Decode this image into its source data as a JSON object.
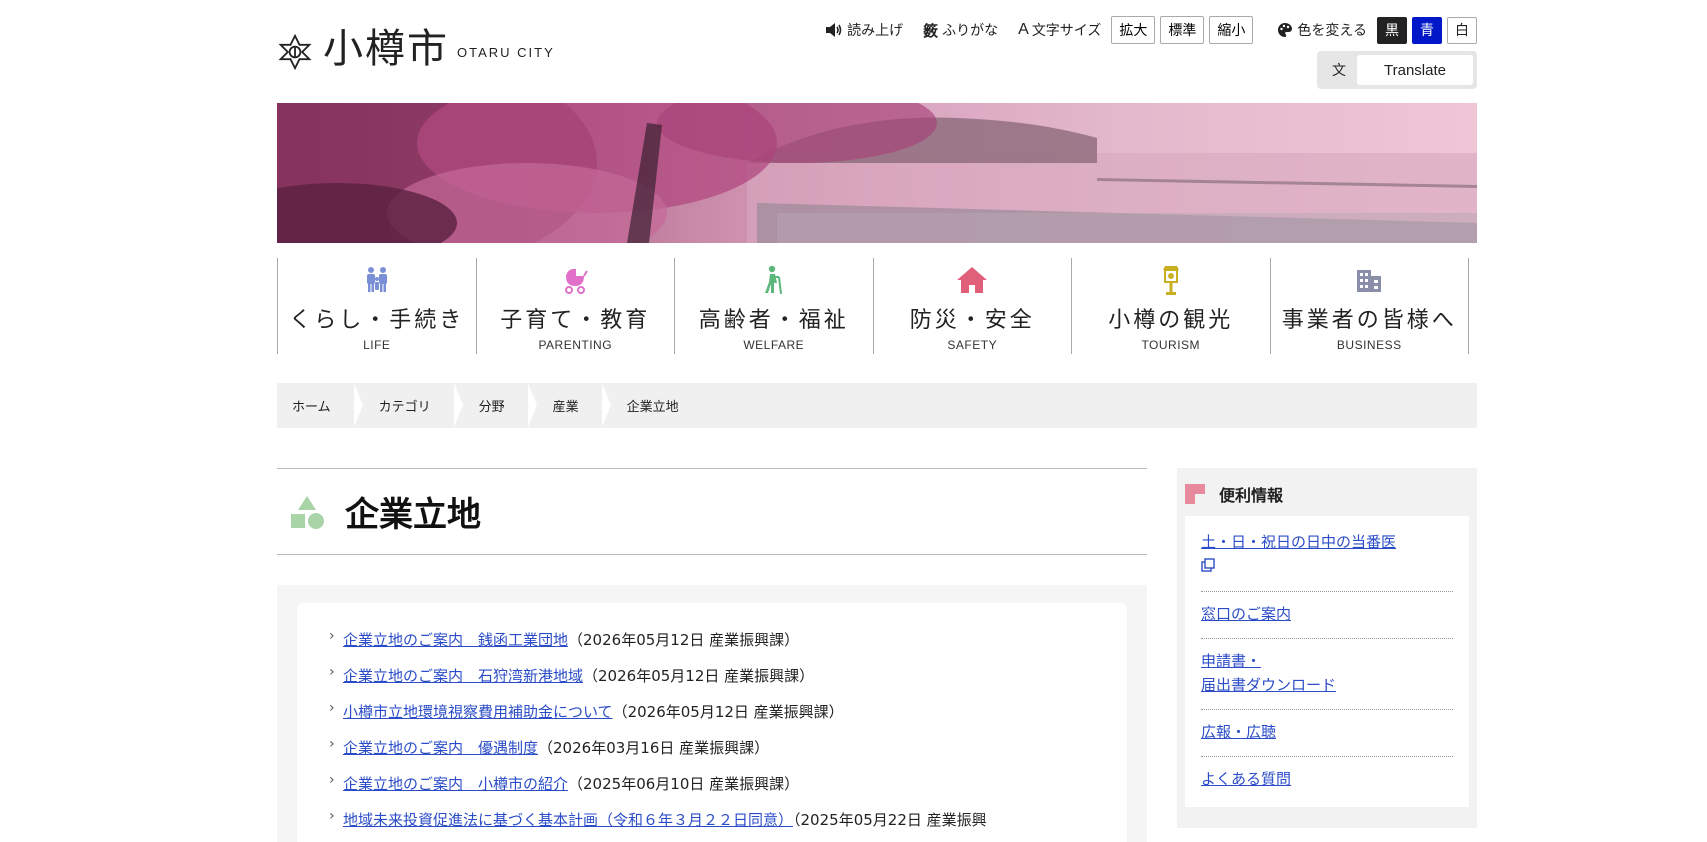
{
  "header": {
    "logo_text": "小樽市",
    "logo_en": "OTARU CITY",
    "tools": {
      "read_aloud": "読み上げ",
      "furigana": "ふりがな",
      "font_size": "文字サイズ",
      "size_large": "拡大",
      "size_normal": "標準",
      "size_small": "縮小",
      "change_color": "色を変える",
      "color_black": "黒",
      "color_blue": "青",
      "color_white": "白"
    },
    "translate_label": "Translate"
  },
  "nav": [
    {
      "label": "くらし・手続き",
      "en": "LIFE",
      "icon": "family-icon",
      "color": "#7b8fd6"
    },
    {
      "label": "子育て・教育",
      "en": "PARENTING",
      "icon": "stroller-icon",
      "color": "#e070c8"
    },
    {
      "label": "高齢者・福祉",
      "en": "WELFARE",
      "icon": "walking-elder-icon",
      "color": "#5cb87a"
    },
    {
      "label": "防災・安全",
      "en": "SAFETY",
      "icon": "house-icon",
      "color": "#e0607a"
    },
    {
      "label": "小樽の観光",
      "en": "TOURISM",
      "icon": "lamp-icon",
      "color": "#c8b020"
    },
    {
      "label": "事業者の皆様へ",
      "en": "BUSINESS",
      "icon": "building-icon",
      "color": "#8a8ea8"
    }
  ],
  "breadcrumb": [
    "ホーム",
    "カテゴリ",
    "分野",
    "産業",
    "企業立地"
  ],
  "main": {
    "title": "企業立地",
    "items": [
      {
        "link": "企業立地のご案内　銭函工業団地",
        "meta": "（2026年05月12日 産業振興課）"
      },
      {
        "link": "企業立地のご案内　石狩湾新港地域",
        "meta": "（2026年05月12日 産業振興課）"
      },
      {
        "link": "小樽市立地環境視察費用補助金について",
        "meta": "（2026年05月12日 産業振興課）"
      },
      {
        "link": "企業立地のご案内　優遇制度",
        "meta": "（2026年03月16日 産業振興課）"
      },
      {
        "link": "企業立地のご案内　小樽市の紹介",
        "meta": "（2025年06月10日 産業振興課）"
      },
      {
        "link": "地域未来投資促進法に基づく基本計画（令和６年３月２２日同意）",
        "meta": "（2025年05月22日 産業振興"
      }
    ]
  },
  "side": {
    "title": "便利情報",
    "items": [
      {
        "label": "土・日・祝日の日中の当番医",
        "external": true
      },
      {
        "label": "窓口のご案内",
        "external": false
      },
      {
        "label": "申請書・\n届出書ダウンロード",
        "external": false
      },
      {
        "label": "広報・広聴",
        "external": false
      },
      {
        "label": "よくある質問",
        "external": false
      }
    ]
  }
}
